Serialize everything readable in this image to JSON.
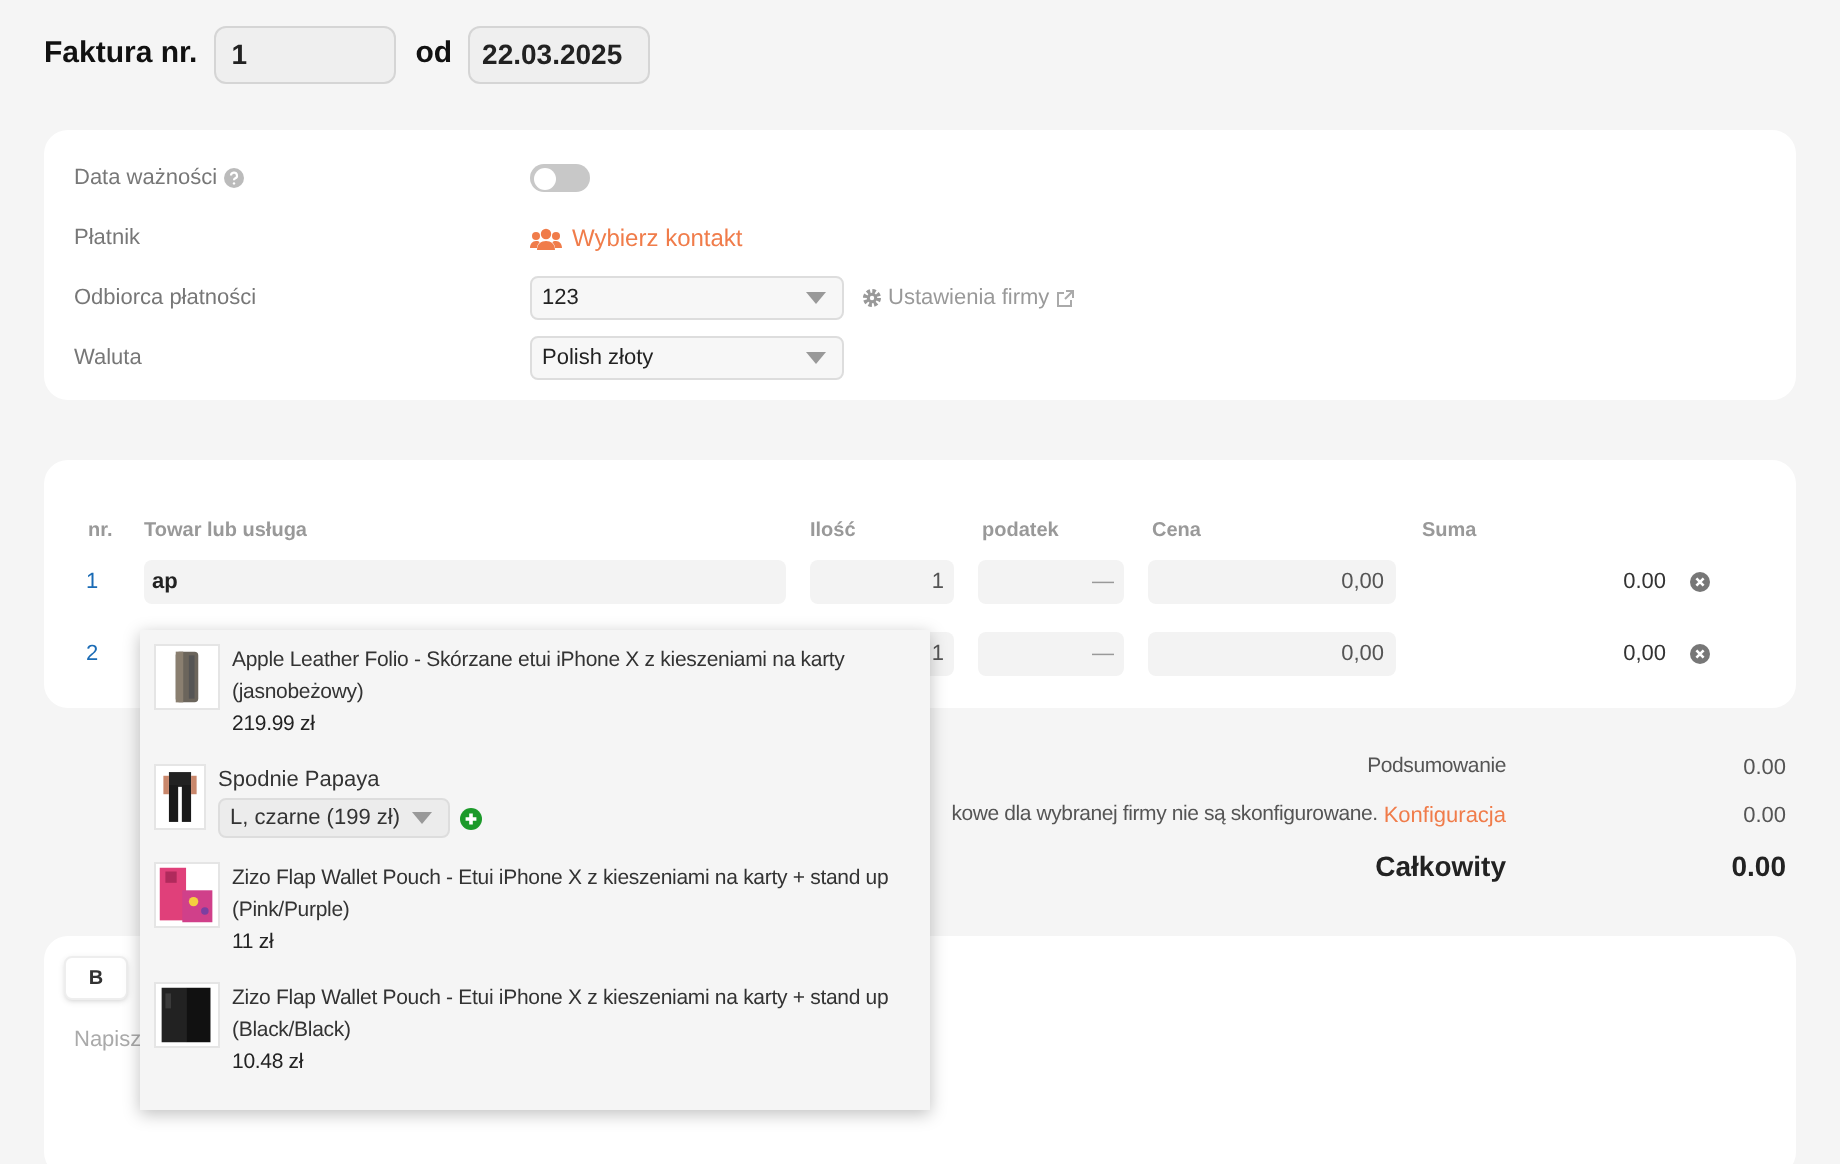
{
  "header": {
    "title": "Faktura nr.",
    "number": "1",
    "date_label": "od",
    "date": "22.03.2025"
  },
  "settings": {
    "rows": [
      {
        "kind": "toggle",
        "label": "Data ważności",
        "on": false
      },
      {
        "kind": "link",
        "label": "Płatnik",
        "value": "Wybierz kontakt"
      },
      {
        "kind": "select",
        "label": "Odbiorca płatności",
        "value": "123",
        "extra_link": "Ustawienia firmy"
      },
      {
        "kind": "select",
        "label": "Waluta",
        "value": "Polish złoty"
      }
    ]
  },
  "items": {
    "columns": [
      "nr.",
      "Towar lub usługa",
      "Ilość",
      "podatek",
      "Cena",
      "Suma"
    ],
    "rows": [
      {
        "nr": "1",
        "name": "ap",
        "quantity": "1",
        "tax": "—",
        "price": "0,00",
        "sum": "0.00"
      },
      {
        "nr": "2",
        "quantity": "1",
        "tax": "—",
        "price": "0,00",
        "sum": "0,00"
      }
    ]
  },
  "summary": [
    {
      "kind": "line",
      "label": "Podsumowanie",
      "value": "0.00"
    },
    {
      "kind": "line",
      "label": "kowe dla wybranej firmy nie są skonfigurowane.",
      "link": "Konfiguracja",
      "value": "0.00"
    },
    {
      "kind": "total",
      "label": "Całkowity",
      "value": "0.00"
    }
  ],
  "editor": {
    "buttons": [
      "B"
    ],
    "placeholder": "Napisz"
  },
  "suggestions": [
    {
      "kind": "product",
      "name": "Apple Leather Folio - Skórzane etui iPhone X z kieszeniami na karty (jasnobeżowy)",
      "price": "219.99 zł"
    },
    {
      "kind": "variants",
      "name": "Spodnie Papaya",
      "variant": "L, czarne (199 zł)"
    },
    {
      "kind": "product",
      "name": "Zizo Flap Wallet Pouch - Etui iPhone X z kieszeniami na karty + stand up (Pink/Purple)",
      "price": "11 zł"
    },
    {
      "kind": "product",
      "name": "Zizo Flap Wallet Pouch - Etui iPhone X z kieszeniami na karty + stand up (Black/Black)",
      "price": "10.48 zł"
    }
  ]
}
